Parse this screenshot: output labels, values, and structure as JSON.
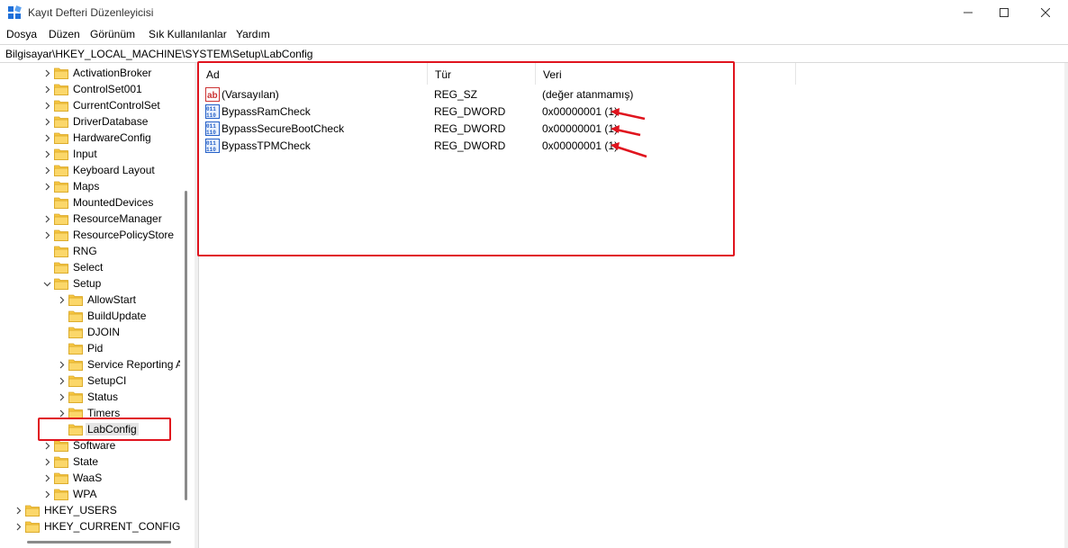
{
  "window": {
    "title": "Kayıt Defteri Düzenleyicisi",
    "minimize_icon": "minimize-icon",
    "maximize_icon": "maximize-icon",
    "close_icon": "close-icon"
  },
  "menu": {
    "items": [
      "Dosya",
      "Düzen",
      "Görünüm",
      "Sık Kullanılanlar",
      "Yardım"
    ]
  },
  "address": {
    "path": "Bilgisayar\\HKEY_LOCAL_MACHINE\\SYSTEM\\Setup\\LabConfig"
  },
  "tree": {
    "items": [
      {
        "label": "ActivationBroker",
        "expandable": true
      },
      {
        "label": "ControlSet001",
        "expandable": true
      },
      {
        "label": "CurrentControlSet",
        "expandable": true
      },
      {
        "label": "DriverDatabase",
        "expandable": true
      },
      {
        "label": "HardwareConfig",
        "expandable": true
      },
      {
        "label": "Input",
        "expandable": true
      },
      {
        "label": "Keyboard Layout",
        "expandable": true
      },
      {
        "label": "Maps",
        "expandable": true
      },
      {
        "label": "MountedDevices",
        "expandable": false
      },
      {
        "label": "ResourceManager",
        "expandable": true
      },
      {
        "label": "ResourcePolicyStore",
        "expandable": true
      },
      {
        "label": "RNG",
        "expandable": false
      },
      {
        "label": "Select",
        "expandable": false
      },
      {
        "label": "Setup",
        "expandable": true,
        "expanded": true
      },
      {
        "label": "AllowStart",
        "expandable": true
      },
      {
        "label": "BuildUpdate",
        "expandable": false
      },
      {
        "label": "DJOIN",
        "expandable": false
      },
      {
        "label": "Pid",
        "expandable": false
      },
      {
        "label": "Service Reporting A",
        "expandable": true
      },
      {
        "label": "SetupCI",
        "expandable": true
      },
      {
        "label": "Status",
        "expandable": true
      },
      {
        "label": "Timers",
        "expandable": true
      },
      {
        "label": "LabConfig",
        "expandable": false,
        "selected": true
      },
      {
        "label": "Software",
        "expandable": true
      },
      {
        "label": "State",
        "expandable": true
      },
      {
        "label": "WaaS",
        "expandable": true
      },
      {
        "label": "WPA",
        "expandable": true
      },
      {
        "label": "HKEY_USERS",
        "expandable": true
      },
      {
        "label": "HKEY_CURRENT_CONFIG",
        "expandable": true
      }
    ]
  },
  "list": {
    "columns": [
      "Ad",
      "Tür",
      "Veri"
    ],
    "rows": [
      {
        "name": "(Varsayılan)",
        "type": "REG_SZ",
        "data": "(değer atanmamış)",
        "icon": "string-value-icon"
      },
      {
        "name": "BypassRamCheck",
        "type": "REG_DWORD",
        "data": "0x00000001 (1)",
        "icon": "dword-value-icon"
      },
      {
        "name": "BypassSecureBootCheck",
        "type": "REG_DWORD",
        "data": "0x00000001 (1)",
        "icon": "dword-value-icon"
      },
      {
        "name": "BypassTPMCheck",
        "type": "REG_DWORD",
        "data": "0x00000001 (1)",
        "icon": "dword-value-icon"
      }
    ]
  },
  "colors": {
    "highlight_red": "#e0141e",
    "folder_yellow": "#f8c844",
    "selection_gray": "#e5e5e5"
  }
}
